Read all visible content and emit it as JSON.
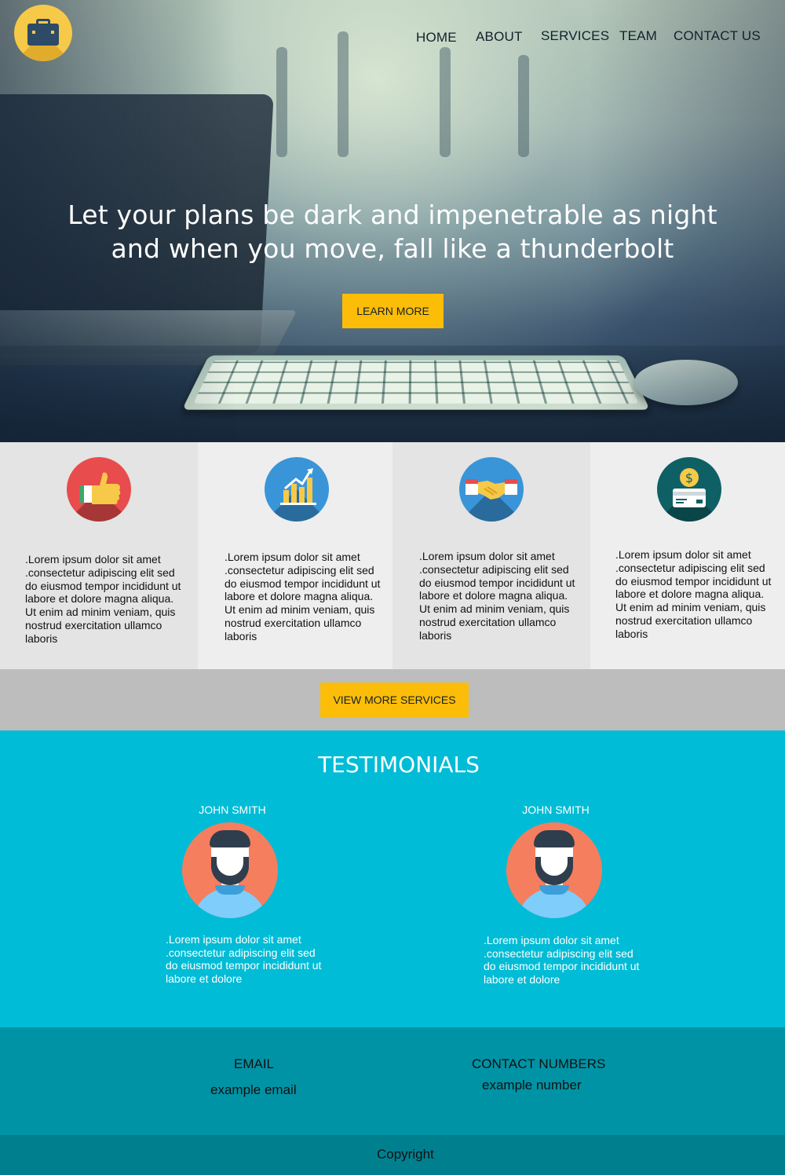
{
  "nav": {
    "items": [
      {
        "label": "HOME"
      },
      {
        "label": "ABOUT"
      },
      {
        "label": "SERVICES"
      },
      {
        "label": "TEAM"
      },
      {
        "label": "CONTACT US"
      }
    ]
  },
  "hero": {
    "headline_line1": "Let your plans be dark and impenetrable as night",
    "headline_line2": "and when you move, fall like a thunderbolt",
    "cta_label": "LEARN MORE"
  },
  "services": {
    "items": [
      {
        "icon": "thumbs-up-icon",
        "color": "#e84c4c",
        "text": ".Lorem ipsum dolor sit amet .consectetur adipiscing elit sed do eiusmod tempor incididunt ut labore et dolore magna aliqua. Ut enim ad minim veniam, quis nostrud exercitation ullamco laboris"
      },
      {
        "icon": "growth-chart-icon",
        "color": "#3a95d8",
        "text": ".Lorem ipsum dolor sit amet .consectetur adipiscing elit sed do eiusmod tempor incididunt ut labore et dolore magna aliqua. Ut enim ad minim veniam, quis nostrud exercitation ullamco laboris"
      },
      {
        "icon": "handshake-icon",
        "color": "#3a95d8",
        "text": ".Lorem ipsum dolor sit amet .consectetur adipiscing elit sed do eiusmod tempor incididunt ut labore et dolore magna aliqua. Ut enim ad minim veniam, quis nostrud exercitation ullamco laboris"
      },
      {
        "icon": "money-card-icon",
        "color": "#0f6065",
        "text": ".Lorem ipsum dolor sit amet .consectetur adipiscing elit sed do eiusmod tempor incididunt ut labore et dolore magna aliqua. Ut enim ad minim veniam, quis nostrud exercitation ullamco laboris"
      }
    ],
    "more_label": "VIEW MORE SERVICES"
  },
  "testimonials": {
    "title": "TESTIMONIALS",
    "items": [
      {
        "name": "JOHN SMITH",
        "quote": ".Lorem ipsum dolor sit amet .consectetur adipiscing elit sed do eiusmod tempor incididunt ut labore et dolore"
      },
      {
        "name": "JOHN SMITH",
        "quote": ".Lorem ipsum dolor sit amet .consectetur adipiscing elit sed do eiusmod tempor incididunt ut labore et dolore"
      }
    ]
  },
  "contact": {
    "email_label": "EMAIL",
    "email_value": "example email",
    "phone_label": "CONTACT NUMBERS",
    "phone_value": "example number"
  },
  "footer": {
    "copyright": "Copyright"
  },
  "colors": {
    "accent": "#fbbd08",
    "testimonials_bg": "#00bcd6",
    "contact_bg": "#0093a5",
    "footer_bg": "#00808f",
    "logo": "#f7c948"
  }
}
